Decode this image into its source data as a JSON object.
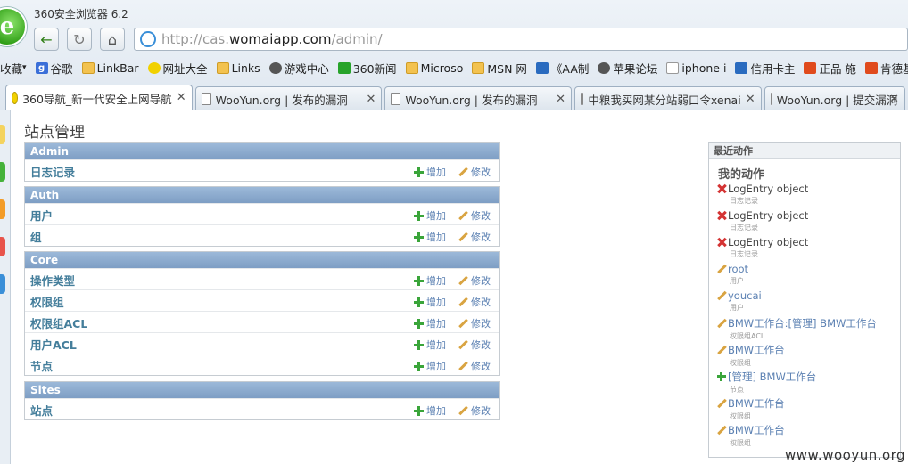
{
  "window": {
    "title": "360安全浏览器 6.2"
  },
  "address": {
    "url_scheme": "http://cas.",
    "url_host": "womaiapp.com",
    "url_path": "/admin/"
  },
  "bookmarks": [
    {
      "label": "收藏",
      "icon": "favorites-icon"
    },
    {
      "label": "谷歌",
      "icon": "google-icon"
    },
    {
      "label": "LinkBar",
      "icon": "folder-icon"
    },
    {
      "label": "网址大全",
      "icon": "360-icon"
    },
    {
      "label": "Links",
      "icon": "folder-icon"
    },
    {
      "label": "游戏中心",
      "icon": "gamepad-icon"
    },
    {
      "label": "360新闻",
      "icon": "360-search-icon"
    },
    {
      "label": "Microso",
      "icon": "folder-icon"
    },
    {
      "label": "MSN 网",
      "icon": "folder-icon"
    },
    {
      "label": "《AA制",
      "icon": "image-icon"
    },
    {
      "label": "苹果论坛",
      "icon": "globe-icon"
    },
    {
      "label": "iphone i",
      "icon": "page-icon"
    },
    {
      "label": "信用卡主",
      "icon": "card-icon"
    },
    {
      "label": "正品 施",
      "icon": "shop-icon"
    },
    {
      "label": "肯德基",
      "icon": "kfc-icon"
    }
  ],
  "tabs": [
    {
      "label": "360导航_新一代安全上网导航",
      "icon": "360-icon",
      "active": true
    },
    {
      "label": "WooYun.org | 发布的漏洞",
      "icon": "page-icon",
      "active": false
    },
    {
      "label": "WooYun.org | 发布的漏洞",
      "icon": "page-icon",
      "active": false
    },
    {
      "label": "中粮我买网某分站弱口令xenai",
      "icon": "page-icon",
      "active": false
    },
    {
      "label": "WooYun.org | 提交漏洞",
      "icon": "page-icon",
      "active": false
    }
  ],
  "page": {
    "title": "站点管理",
    "add_label": "增加",
    "change_label": "修改",
    "modules": [
      {
        "name": "Admin",
        "rows": [
          "日志记录"
        ]
      },
      {
        "name": "Auth",
        "rows": [
          "用户",
          "组"
        ]
      },
      {
        "name": "Core",
        "rows": [
          "操作类型",
          "权限组",
          "权限组ACL",
          "用户ACL",
          "节点"
        ]
      },
      {
        "name": "Sites",
        "rows": [
          "站点"
        ]
      }
    ]
  },
  "recent": {
    "caption": "最近动作",
    "heading": "我的动作",
    "actions": [
      {
        "type": "delete",
        "text": "LogEntry object",
        "model": "日志记录"
      },
      {
        "type": "delete",
        "text": "LogEntry object",
        "model": "日志记录"
      },
      {
        "type": "delete",
        "text": "LogEntry object",
        "model": "日志记录"
      },
      {
        "type": "change",
        "text": "root",
        "model": "用户"
      },
      {
        "type": "change",
        "text": "youcai",
        "model": "用户"
      },
      {
        "type": "change",
        "text": "BMW工作台:[管理] BMW工作台",
        "model": "权限组ACL"
      },
      {
        "type": "change",
        "text": "BMW工作台",
        "model": "权限组"
      },
      {
        "type": "add",
        "text": "[管理] BMW工作台",
        "model": "节点"
      },
      {
        "type": "change",
        "text": "BMW工作台",
        "model": "权限组"
      },
      {
        "type": "change",
        "text": "BMW工作台",
        "model": "权限组"
      }
    ]
  },
  "watermark": "www.wooyun.org"
}
